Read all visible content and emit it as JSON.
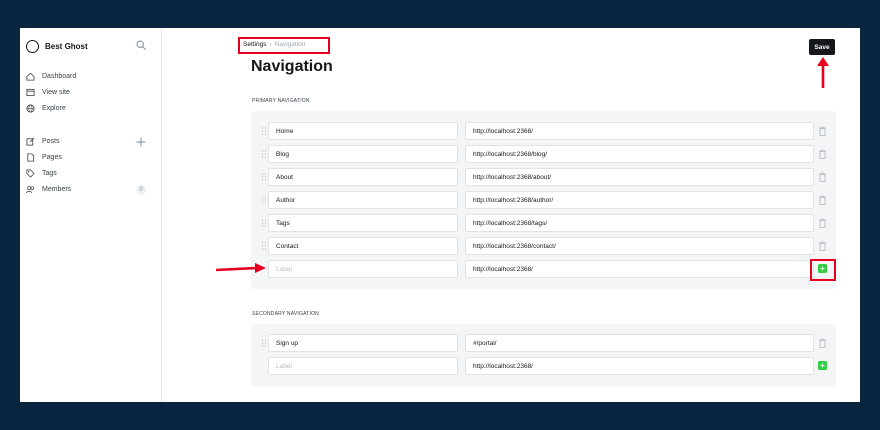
{
  "sidebar": {
    "brand": "Best Ghost",
    "items": [
      {
        "label": "Dashboard",
        "icon": "home-icon"
      },
      {
        "label": "View site",
        "icon": "window-icon"
      },
      {
        "label": "Explore",
        "icon": "globe-icon"
      },
      {
        "label": "Posts",
        "icon": "edit-icon"
      },
      {
        "label": "Pages",
        "icon": "page-icon"
      },
      {
        "label": "Tags",
        "icon": "tag-icon"
      },
      {
        "label": "Members",
        "icon": "members-icon"
      }
    ],
    "members_count": "0"
  },
  "header": {
    "breadcrumb_root": "Settings",
    "breadcrumb_sep": "›",
    "breadcrumb_current": "Navigation",
    "title": "Navigation",
    "save_label": "Save"
  },
  "primary": {
    "label": "PRIMARY NAVIGATION",
    "rows": [
      {
        "label": "Home",
        "url": "http://localhost:2368/"
      },
      {
        "label": "Blog",
        "url": "http://localhost:2368/blog/"
      },
      {
        "label": "About",
        "url": "http://localhost:2368/about/"
      },
      {
        "label": "Author",
        "url": "http://localhost:2368/author/"
      },
      {
        "label": "Tags",
        "url": "http://localhost:2368/tags/"
      },
      {
        "label": "Contact",
        "url": "http://localhost:2368/contact/"
      }
    ],
    "new_placeholder": "Label",
    "new_url": "http://localhost:2368/"
  },
  "secondary": {
    "label": "SECONDARY NAVIGATION",
    "rows": [
      {
        "label": "Sign up",
        "url": "#/portal/"
      }
    ],
    "new_placeholder": "Label",
    "new_url": "http://localhost:2368/"
  },
  "colors": {
    "accent_red": "#e6001f",
    "add_green": "#30cf43",
    "backdrop": "#0a2540"
  }
}
